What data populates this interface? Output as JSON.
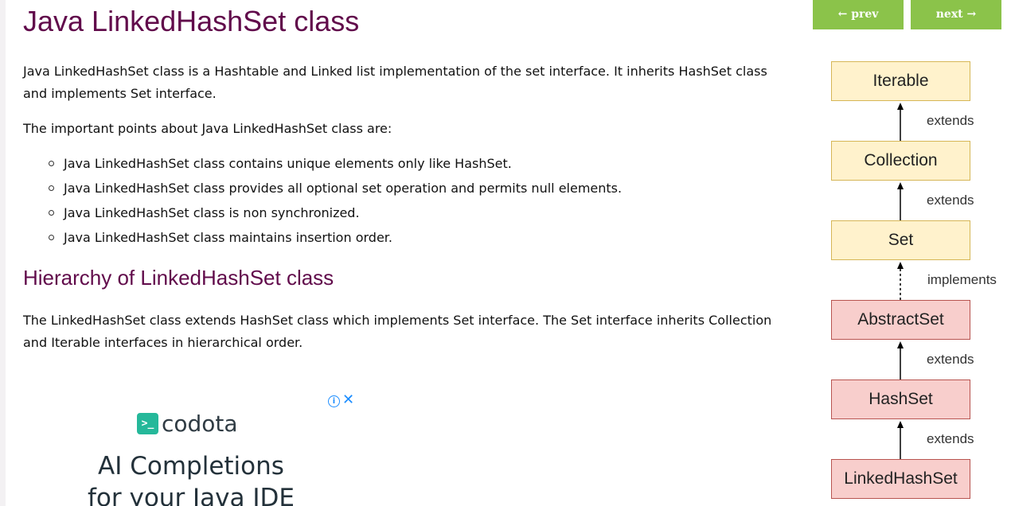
{
  "nav": {
    "prev_label": "← prev",
    "next_label": "next →"
  },
  "article": {
    "title": "Java LinkedHashSet class",
    "intro": "Java LinkedHashSet class is a Hashtable and Linked list implementation of the set interface. It inherits HashSet class and implements Set interface.",
    "points_intro": "The important points about Java LinkedHashSet class are:",
    "points": [
      "Java LinkedHashSet class contains unique elements only like HashSet.",
      "Java LinkedHashSet class provides all optional set operation and permits null elements.",
      "Java LinkedHashSet class is non synchronized.",
      "Java LinkedHashSet class maintains insertion order."
    ],
    "hierarchy_heading": "Hierarchy of LinkedHashSet class",
    "hierarchy_text": "The LinkedHashSet class extends HashSet class which implements Set interface. The Set interface inherits Collection and Iterable interfaces in hierarchical order."
  },
  "diagram": {
    "nodes": [
      {
        "label": "Iterable",
        "kind": "interface"
      },
      {
        "label": "Collection",
        "kind": "interface"
      },
      {
        "label": "Set",
        "kind": "interface"
      },
      {
        "label": "AbstractSet",
        "kind": "class"
      },
      {
        "label": "HashSet",
        "kind": "class"
      },
      {
        "label": "LinkedHashSet",
        "kind": "class"
      }
    ],
    "edges": [
      {
        "label": "extends",
        "style": "solid"
      },
      {
        "label": "extends",
        "style": "solid"
      },
      {
        "label": "implements",
        "style": "dashed"
      },
      {
        "label": "extends",
        "style": "solid"
      },
      {
        "label": "extends",
        "style": "solid"
      }
    ],
    "colors": {
      "interface_fill": "#fff2cc",
      "interface_border": "#d6b656",
      "class_fill": "#f8cecc",
      "class_border": "#b85450"
    }
  },
  "ad": {
    "info_icon": "info-icon",
    "close_icon": "close-icon",
    "logo_glyph": ">_",
    "brand": "codota",
    "headline_line1": "AI Completions",
    "headline_line2": "for your Java IDE"
  },
  "colors": {
    "heading": "#610b4b",
    "nav_button": "#8bc34a",
    "ad_accent": "#25b89a"
  }
}
